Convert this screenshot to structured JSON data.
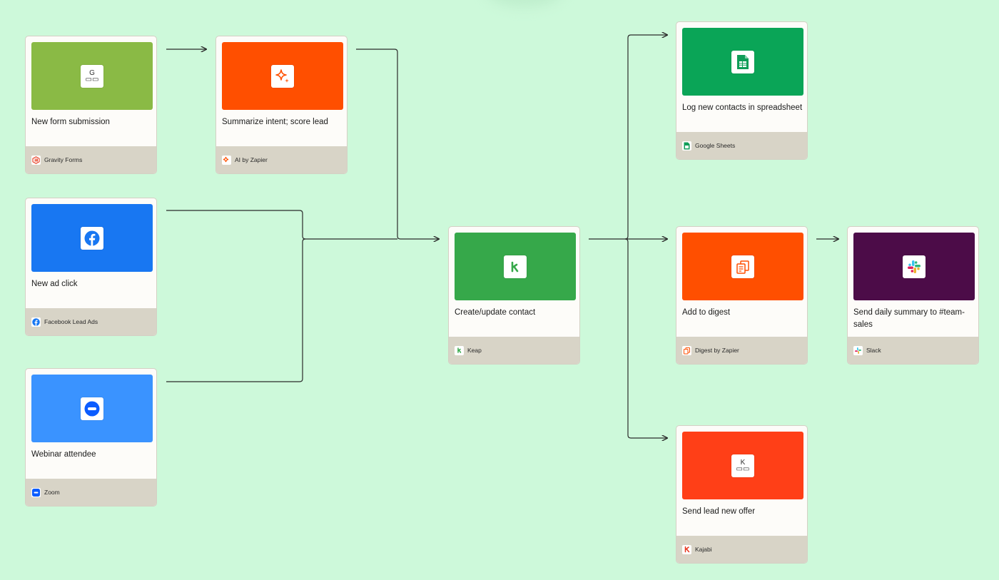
{
  "colors": {
    "canvas": "#cdf9da",
    "gravity": "#8aba45",
    "ai": "#ff4f00",
    "facebook": "#1877f2",
    "zoom": "#3a93ff",
    "keap": "#36a84a",
    "sheets": "#0aa557",
    "digest": "#ff4f00",
    "slack": "#4c0c48",
    "kajabi": "#ff3f17"
  },
  "steps": {
    "gravity": {
      "title": "New form submission",
      "app": "Gravity Forms",
      "icon": "gravity-forms-icon"
    },
    "ai": {
      "title": "Summarize intent; score lead",
      "app": "AI by Zapier",
      "icon": "sparkle-icon"
    },
    "facebook": {
      "title": "New ad click",
      "app": "Facebook Lead Ads",
      "icon": "facebook-icon"
    },
    "zoom": {
      "title": "Webinar attendee",
      "app": "Zoom",
      "icon": "zoom-icon"
    },
    "keap": {
      "title": "Create/update contact",
      "app": "Keap",
      "icon": "keap-icon"
    },
    "sheets": {
      "title": "Log new contacts in spreadsheet",
      "app": "Google Sheets",
      "icon": "google-sheets-icon"
    },
    "digest": {
      "title": "Add to digest",
      "app": "Digest by Zapier",
      "icon": "digest-icon"
    },
    "slack": {
      "title": "Send daily summary to #team-sales",
      "app": "Slack",
      "icon": "slack-icon"
    },
    "kajabi": {
      "title": "Send lead new offer",
      "app": "Kajabi",
      "icon": "kajabi-icon"
    }
  }
}
